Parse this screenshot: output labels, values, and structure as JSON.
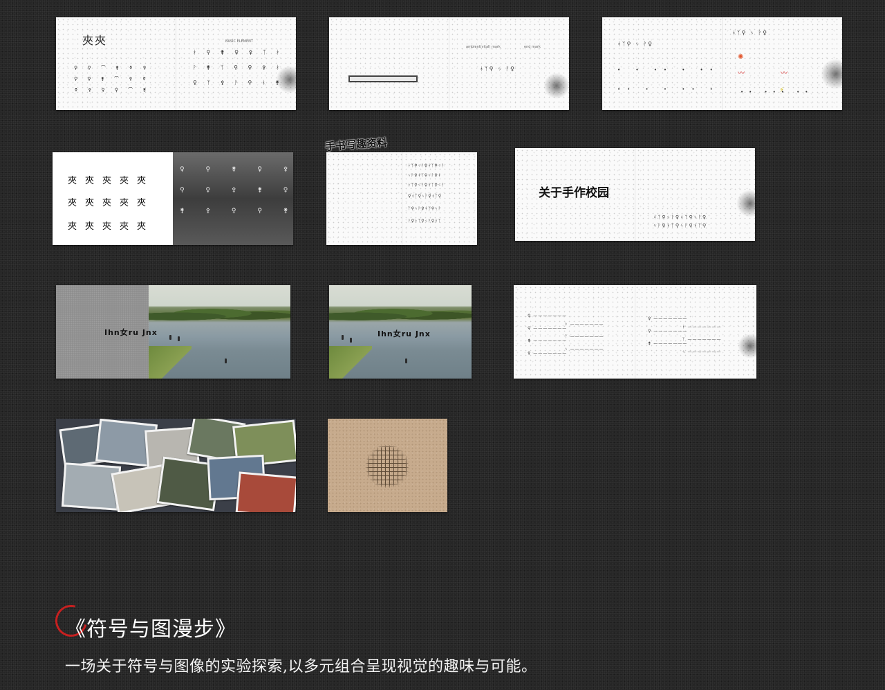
{
  "project": {
    "title": "《符号与图漫步》",
    "subtitle": "一场关于符号与图像的实验探索,以多元组合呈现视觉的趣味与可能。"
  },
  "thumbnails": {
    "t1": {
      "heading_glyphs": "夾夾",
      "label": "BASIC ELEMENT"
    },
    "t2": {
      "label_left": "ambient(vital) mark",
      "label_right": "end mark"
    },
    "t5": {
      "badge": "手书写趣资料"
    },
    "t6": {
      "logo": "关于手作校园"
    },
    "t7": {
      "overlay": "Ihn女ru Jnx"
    },
    "t8": {
      "overlay": "Ihn女ru Jnx"
    }
  },
  "colors": {
    "background": "#262626",
    "accent": "#c62020",
    "text": "#ffffff"
  }
}
